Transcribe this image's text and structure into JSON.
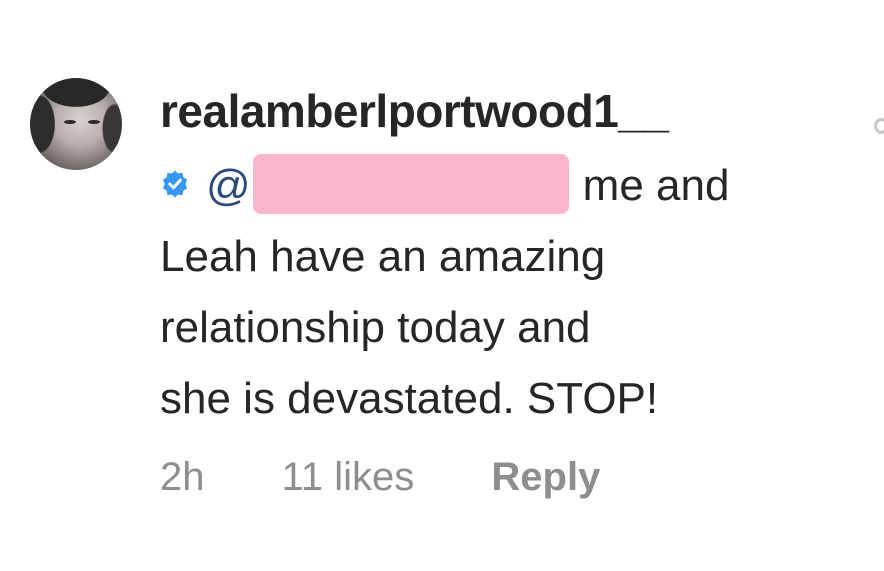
{
  "comment": {
    "username": "realamberlportwood1__",
    "mention_prefix": "@",
    "line1_tail": "me and",
    "line2": "Leah have an amazing",
    "line3": "relationship today and",
    "line4": "she is devastated. STOP!",
    "time": "2h",
    "likes": "11 likes",
    "reply_label": "Reply"
  },
  "colors": {
    "verified_badge": "#3897f0",
    "redaction": "#f8b5cb",
    "meta_text": "#8e8e8e",
    "text": "#262626"
  },
  "icons": {
    "verified": "verified-badge-icon",
    "side_like": "heart-outline-icon"
  }
}
